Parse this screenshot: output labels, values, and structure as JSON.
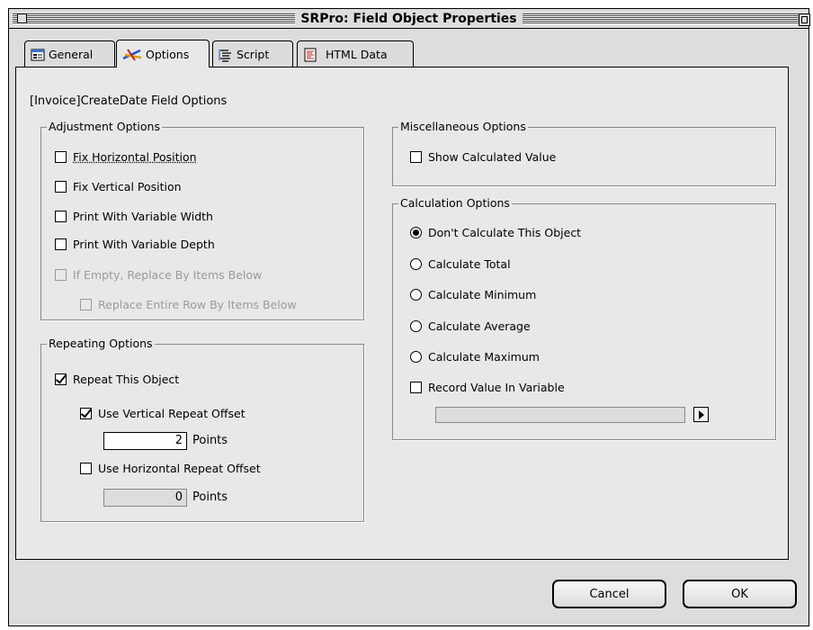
{
  "window": {
    "title": "SRPro: Field Object Properties"
  },
  "tabs": [
    {
      "label": "General",
      "icon": "general-icon",
      "active": false
    },
    {
      "label": "Options",
      "icon": "options-icon",
      "active": true
    },
    {
      "label": "Script",
      "icon": "script-icon",
      "active": false
    },
    {
      "label": "HTML Data",
      "icon": "html-data-icon",
      "active": false
    }
  ],
  "field_title": "[Invoice]CreateDate Field Options",
  "adjustment": {
    "label": "Adjustment Options",
    "items": [
      {
        "label": "Fix Horizontal Position",
        "checked": false,
        "enabled": true
      },
      {
        "label": "Fix Vertical Position",
        "checked": false,
        "enabled": true
      },
      {
        "label": "Print With Variable Width",
        "checked": false,
        "enabled": true
      },
      {
        "label": "Print With Variable Depth",
        "checked": false,
        "enabled": true
      },
      {
        "label": "If Empty, Replace By Items Below",
        "checked": false,
        "enabled": false
      },
      {
        "label": "Replace Entire Row By Items Below",
        "checked": false,
        "enabled": false
      }
    ]
  },
  "repeating": {
    "label": "Repeating Options",
    "repeat_object": {
      "label": "Repeat This Object",
      "checked": true
    },
    "vertical_offset": {
      "label": "Use Vertical Repeat Offset",
      "checked": true,
      "value": "2",
      "unit": "Points"
    },
    "horizontal_offset": {
      "label": "Use Horizontal Repeat Offset",
      "checked": false,
      "value": "0",
      "unit": "Points"
    }
  },
  "misc": {
    "label": "Miscellaneous Options",
    "show_calculated": {
      "label": "Show Calculated Value",
      "checked": false
    }
  },
  "calculation": {
    "label": "Calculation Options",
    "options": [
      {
        "label": "Don't Calculate This Object",
        "selected": true
      },
      {
        "label": "Calculate Total",
        "selected": false
      },
      {
        "label": "Calculate Minimum",
        "selected": false
      },
      {
        "label": "Calculate Average",
        "selected": false
      },
      {
        "label": "Calculate Maximum",
        "selected": false
      }
    ],
    "record_value": {
      "label": "Record Value In Variable",
      "checked": false
    },
    "variable_value": ""
  },
  "buttons": {
    "cancel": "Cancel",
    "ok": "OK"
  }
}
